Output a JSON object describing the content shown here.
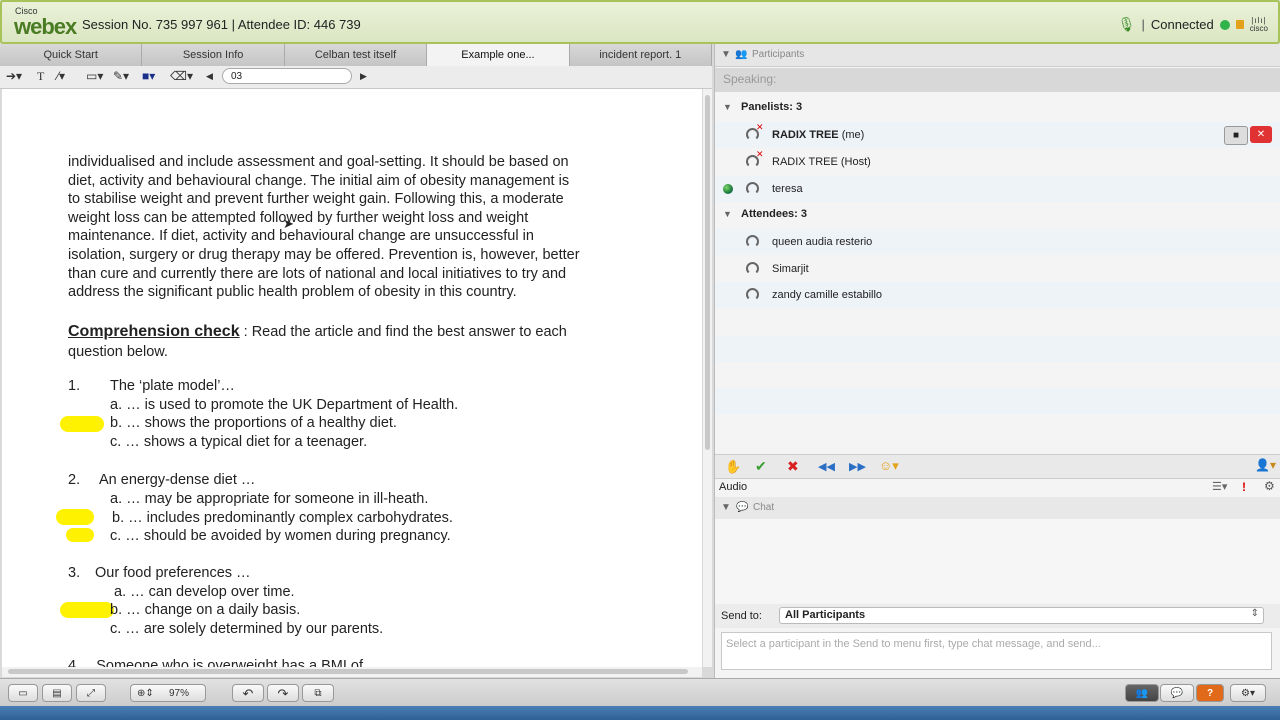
{
  "topbar": {
    "logo_small": "Cisco",
    "logo_big": "webex",
    "session_info": "Session No. 735 997 961 | Attendee ID: 446 739",
    "separator": "|",
    "status": "Connected",
    "cisco_brand": "cisco"
  },
  "tabs": [
    {
      "label": "Quick Start",
      "active": false
    },
    {
      "label": "Session Info",
      "active": false
    },
    {
      "label": "Celban test itself",
      "active": false
    },
    {
      "label": "Example one...",
      "active": true
    },
    {
      "label": "incident report. 1",
      "active": false
    }
  ],
  "toolbar": {
    "text_tool": "T",
    "page_value": "03"
  },
  "document": {
    "paragraph": [
      "individualised and include assessment and goal-setting. It should be based on",
      "diet, activity and behavioural change. The initial aim of obesity management is",
      "to stabilise weight and prevent further weight gain. Following this, a moderate",
      "weight loss can be attempted followed by further weight loss and weight",
      "maintenance. If diet, activity and behavioural change are unsuccessful in",
      "isolation, surgery or drug therapy may be offered. Prevention is, however, better",
      "than cure and currently there are lots of national and local initiatives to try and",
      "address the significant public health problem of obesity in this country."
    ],
    "comp_title": "Comprehension check",
    "comp_colon": ":",
    "comp_instruction": "Read the article and find the best answer to each",
    "comp_instruction2": "question below.",
    "q1": {
      "num": "1.",
      "text": "The ‘plate model’…",
      "a": "a. … is used to promote the UK Department of Health.",
      "b": "b. … shows the proportions of a healthy diet.",
      "c": "c. … shows a typical diet for a teenager."
    },
    "q2": {
      "num": "2.",
      "text": "An energy-dense diet …",
      "a": "a. … may be appropriate for someone in ill-heath.",
      "b": "b. … includes predominantly complex carbohydrates.",
      "c": "c. … should be avoided by women during pregnancy."
    },
    "q3": {
      "num": "3.",
      "text": "Our food preferences …",
      "a": "a. … can develop over time.",
      "b": "b. … change on a daily basis.",
      "c": "c. … are solely determined by our parents."
    },
    "q4_partial": "4.    Someone who is overweight has a BMI of"
  },
  "participants": {
    "header": "Participants",
    "speaking": "Speaking:",
    "panelists_label": "Panelists: 3",
    "panelists": [
      {
        "name": "RADIX TREE",
        "suffix": "(me)",
        "bold": true
      },
      {
        "name": "RADIX TREE (Host)",
        "suffix": "",
        "bold": false
      },
      {
        "name": "teresa",
        "suffix": "",
        "bold": false
      }
    ],
    "attendees_label": "Attendees: 3",
    "attendees": [
      {
        "name": "queen audia resterio"
      },
      {
        "name": "Simarjit"
      },
      {
        "name": "zandy camille estabillo"
      }
    ]
  },
  "audio": {
    "label": "Audio"
  },
  "chat": {
    "header": "Chat",
    "send_to_label": "Send to:",
    "send_to_value": "All Participants",
    "placeholder": "Select a participant in the Send to menu first, type chat message, and send..."
  },
  "bottombar": {
    "zoom": "97%"
  },
  "colors": {
    "accent_green": "#a7c35a",
    "highlight": "#fff200",
    "status_green": "#2fb34a"
  }
}
